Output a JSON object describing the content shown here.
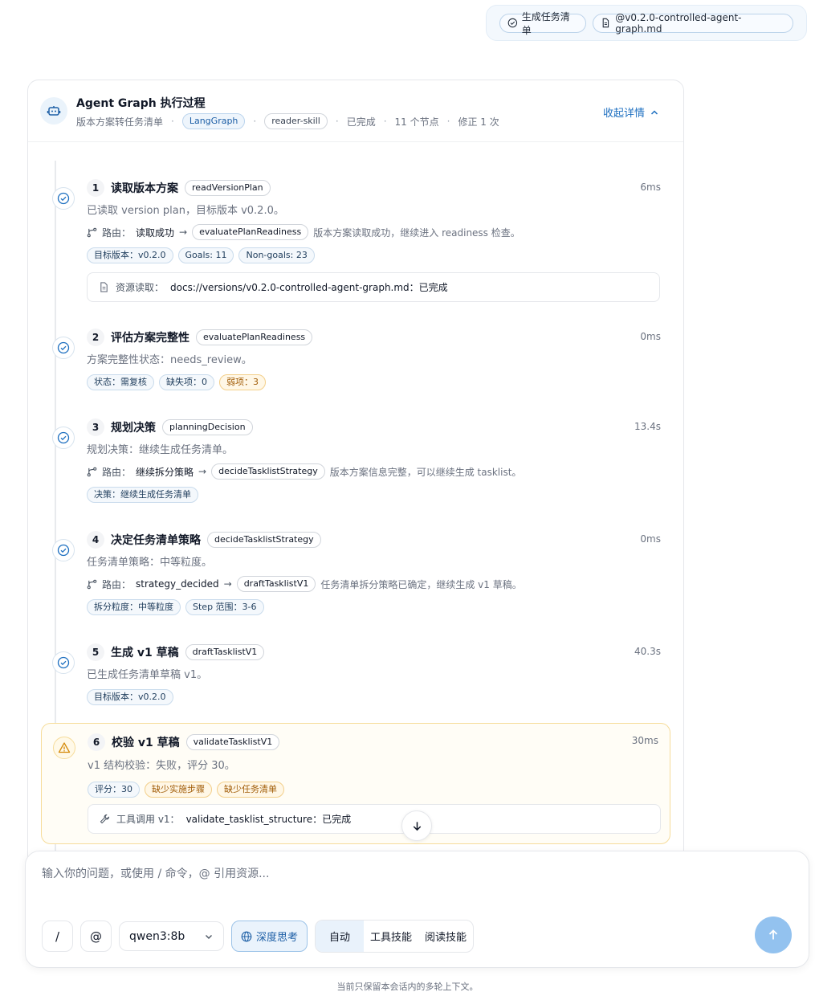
{
  "user_chips": {
    "tasklist": "生成任务清单",
    "file": "@v0.2.0-controlled-agent-graph.md"
  },
  "card": {
    "title": "Agent Graph 执行过程",
    "meta": {
      "desc": "版本方案转任务清单",
      "engine": "LangGraph",
      "skill": "reader-skill",
      "status": "已完成",
      "nodes": "11 个节点",
      "revision": "修正 1 次"
    },
    "collapse_label": "收起详情"
  },
  "nodes": [
    {
      "num": "1",
      "title": "读取版本方案",
      "fn": "readVersionPlan",
      "time": "6ms",
      "desc": "已读取 version plan，目标版本 v0.2.0。",
      "route": {
        "label": "路由：",
        "from": "读取成功",
        "to": "evaluatePlanReadiness",
        "note": "版本方案读取成功，继续进入 readiness 检查。"
      },
      "badges": [
        "目标版本：v0.2.0",
        "Goals: 11",
        "Non-goals: 23"
      ],
      "resource": {
        "label": "资源读取：",
        "value": "docs://versions/v0.2.0-controlled-agent-graph.md：已完成"
      }
    },
    {
      "num": "2",
      "title": "评估方案完整性",
      "fn": "evaluatePlanReadiness",
      "time": "0ms",
      "desc": "方案完整性状态：needs_review。",
      "badges": [
        "状态：需复核",
        "缺失项：0"
      ],
      "warn_badges": [
        "弱项：3"
      ]
    },
    {
      "num": "3",
      "title": "规划决策",
      "fn": "planningDecision",
      "time": "13.4s",
      "desc": "规划决策：继续生成任务清单。",
      "route": {
        "label": "路由：",
        "from": "继续拆分策略",
        "to": "decideTasklistStrategy",
        "note": "版本方案信息完整，可以继续生成 tasklist。"
      },
      "badges": [
        "决策：继续生成任务清单"
      ]
    },
    {
      "num": "4",
      "title": "决定任务清单策略",
      "fn": "decideTasklistStrategy",
      "time": "0ms",
      "desc": "任务清单策略：中等粒度。",
      "route": {
        "label": "路由：",
        "from": "strategy_decided",
        "to": "draftTasklistV1",
        "note": "任务清单拆分策略已确定，继续生成 v1 草稿。"
      },
      "badges": [
        "拆分粒度：中等粒度",
        "Step 范围：3-6"
      ]
    },
    {
      "num": "5",
      "title": "生成 v1 草稿",
      "fn": "draftTasklistV1",
      "time": "40.3s",
      "desc": "已生成任务清单草稿 v1。",
      "badges": [
        "目标版本：v0.2.0"
      ]
    },
    {
      "num": "6",
      "title": "校验 v1 草稿",
      "fn": "validateTasklistV1",
      "time": "30ms",
      "desc": "v1 结构校验：失败，评分 30。",
      "badges": [
        "评分：30"
      ],
      "warn_badges": [
        "缺少实施步骤",
        "缺少任务清单"
      ],
      "tool": {
        "label": "工具调用 v1：",
        "value": "validate_tasklist_structure：已完成"
      }
    }
  ],
  "composer": {
    "placeholder": "输入你的问题，或使用 / 命令，@ 引用资源...",
    "slash": "/",
    "at": "@",
    "model": "qwen3:8b",
    "think": "深度思考",
    "modes": [
      "自动",
      "工具技能",
      "阅读技能"
    ]
  },
  "footnote": "当前只保留本会话内的多轮上下文。"
}
